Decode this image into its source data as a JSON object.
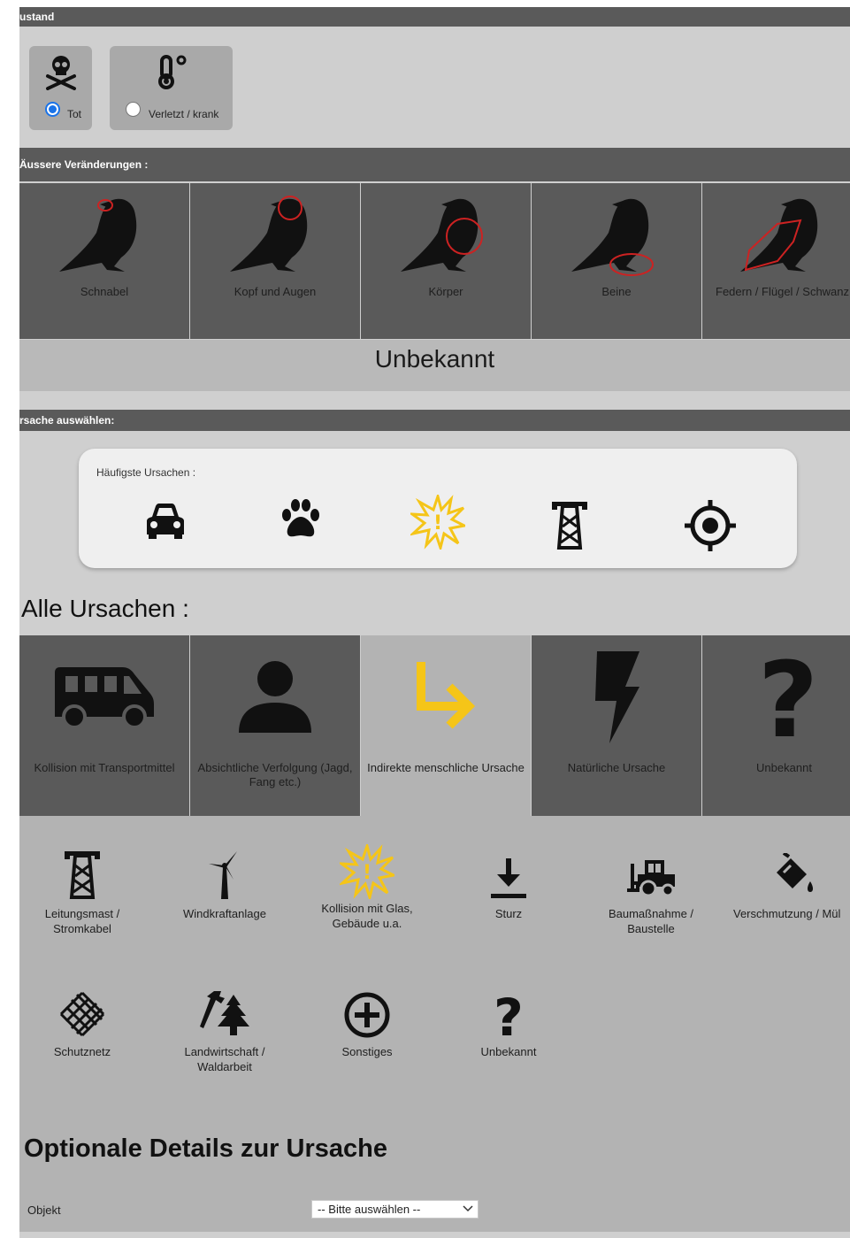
{
  "zustand": {
    "header": "ustand",
    "options": [
      {
        "label": "Tot",
        "icon": "skull-crossbones-icon",
        "checked": true
      },
      {
        "label": "Verletzt / krank",
        "icon": "thermometer-icon",
        "checked": false
      }
    ]
  },
  "veraenderungen": {
    "header": "Äussere Veränderungen :",
    "parts": [
      {
        "label": "Schnabel",
        "icon": "crow-beak-icon"
      },
      {
        "label": "Kopf und Augen",
        "icon": "crow-head-icon"
      },
      {
        "label": "Körper",
        "icon": "crow-body-icon"
      },
      {
        "label": "Beine",
        "icon": "crow-legs-icon"
      },
      {
        "label": "Federn / Flügel / Schwanz",
        "icon": "crow-wing-icon"
      }
    ],
    "unknown": "Unbekannt"
  },
  "ursache": {
    "header": "rsache auswählen:",
    "frequent_title": "Häufigste Ursachen :",
    "frequent_icons": [
      "car-icon",
      "paw-icon",
      "impact-icon",
      "power-pylon-icon",
      "crosshair-icon"
    ],
    "all_title": "Alle Ursachen :",
    "categories": [
      {
        "label": "Kollision mit Transportmittel",
        "icon": "van-icon",
        "selected": false
      },
      {
        "label": "Absichtliche Verfolgung (Jagd, Fang etc.)",
        "icon": "person-icon",
        "selected": false
      },
      {
        "label": "Indirekte menschliche Ursache",
        "icon": "turn-right-arrow-icon",
        "selected": true
      },
      {
        "label": "Natürliche Ursache",
        "icon": "lightning-icon",
        "selected": false
      },
      {
        "label": "Unbekannt",
        "icon": "question-mark-icon",
        "selected": false
      }
    ],
    "subcauses": [
      {
        "label1": "Leitungsmast /",
        "label2": "Stromkabel",
        "icon": "power-pylon-icon"
      },
      {
        "label1": "Windkraftanlage",
        "label2": "",
        "icon": "wind-turbine-icon"
      },
      {
        "label1": "Kollision mit Glas,",
        "label2": "Gebäude u.a.",
        "icon": "impact-icon"
      },
      {
        "label1": "Sturz",
        "label2": "",
        "icon": "fall-arrow-icon"
      },
      {
        "label1": "Baumaßnahme /",
        "label2": "Baustelle",
        "icon": "tractor-icon"
      },
      {
        "label1": "Verschmutzung / Mül",
        "label2": "",
        "icon": "paint-bucket-icon"
      },
      {
        "label1": "Schutznetz",
        "label2": "",
        "icon": "net-icon"
      },
      {
        "label1": "Landwirtschaft /",
        "label2": "Waldarbeit",
        "icon": "axe-tree-icon"
      },
      {
        "label1": "Sonstiges",
        "label2": "",
        "icon": "plus-circle-icon"
      },
      {
        "label1": "Unbekannt",
        "label2": "",
        "icon": "question-mark-icon"
      }
    ]
  },
  "details": {
    "title": "Optionale Details zur Ursache",
    "object_label": "Objekt",
    "object_value": "-- Bitte auswählen --"
  },
  "colors": {
    "accent_yellow": "#f5c518",
    "selected_radio": "#1a73e8",
    "tile_dark": "#5a5a5a",
    "tile_light": "#b3b3b3"
  }
}
